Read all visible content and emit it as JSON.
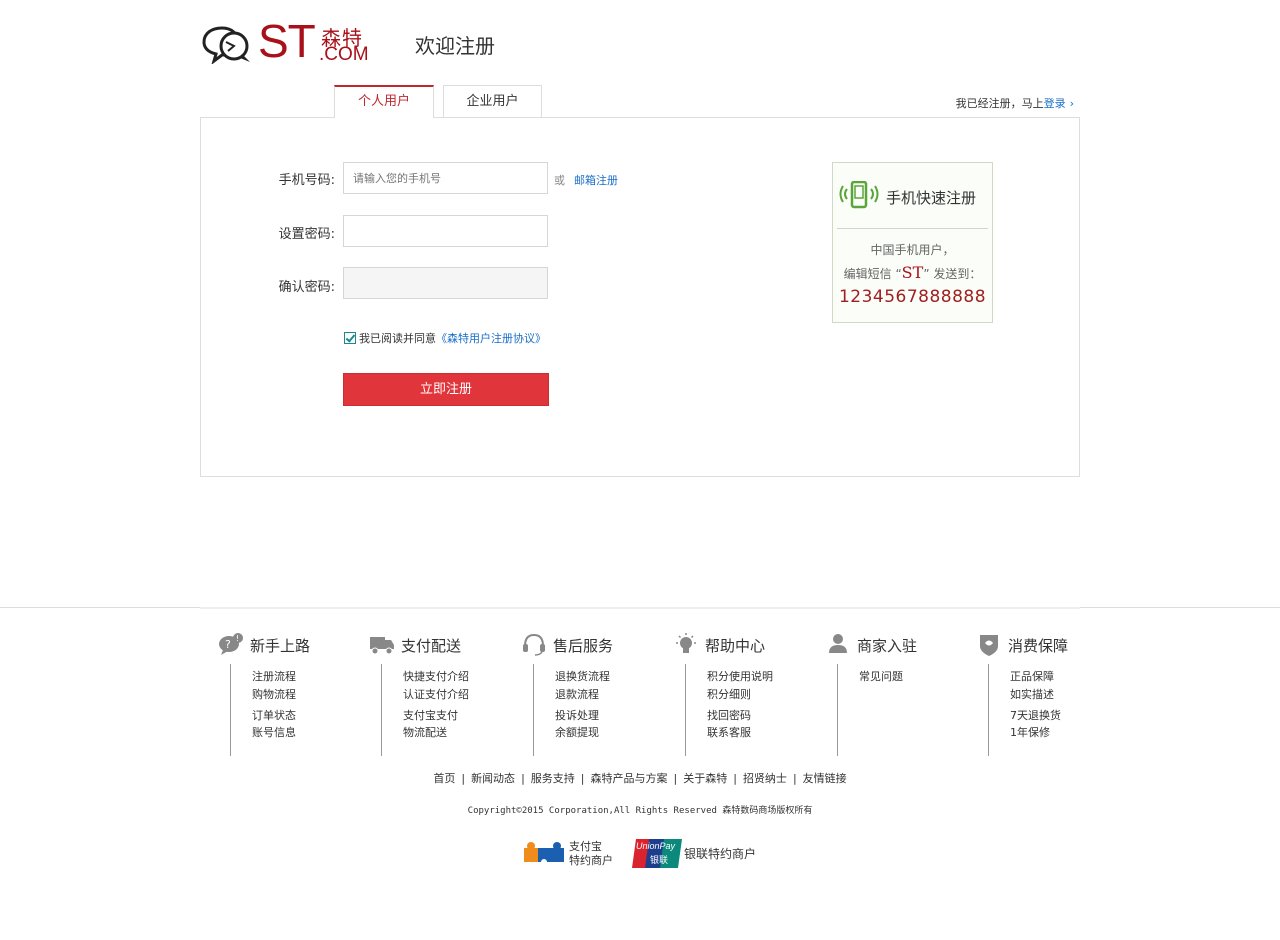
{
  "header": {
    "logo_letters": "ST",
    "logo_cn": "森特",
    "logo_com": ".COM",
    "welcome": "欢迎注册"
  },
  "tabs": [
    {
      "label": "个人用户",
      "active": true
    },
    {
      "label": "企业用户",
      "active": false
    }
  ],
  "login_hint": {
    "text": "我已经注册，马上",
    "link": "登录"
  },
  "form": {
    "phone_label": "手机号码:",
    "phone_placeholder": "请输入您的手机号",
    "or_text": "或",
    "email_register_link": "邮箱注册",
    "password_label": "设置密码:",
    "confirm_label": "确认密码:",
    "agree_text": "我已阅读并同意",
    "agreement_link": "《森特用户注册协议》",
    "agree_checked": true,
    "submit_label": "立即注册"
  },
  "quick_register": {
    "title": "手机快速注册",
    "line1": "中国手机用户，",
    "line2_prefix": "编辑短信 “",
    "line2_code": "ST",
    "line2_suffix": "” 发送到：",
    "number": "1234567888888"
  },
  "footer_columns": [
    {
      "icon": "question-chat-icon",
      "title": "新手上路",
      "items": [
        "注册流程",
        "购物流程",
        "订单状态",
        "账号信息"
      ]
    },
    {
      "icon": "truck-icon",
      "title": "支付配送",
      "items": [
        "快捷支付介绍",
        "认证支付介绍",
        "支付宝支付",
        "物流配送"
      ]
    },
    {
      "icon": "headset-icon",
      "title": "售后服务",
      "items": [
        "退换货流程",
        "退款流程",
        "投诉处理",
        "余额提现"
      ]
    },
    {
      "icon": "lightbulb-icon",
      "title": "帮助中心",
      "items": [
        "积分使用说明",
        "积分细则",
        "找回密码",
        "联系客服"
      ]
    },
    {
      "icon": "person-icon",
      "title": "商家入驻",
      "items": [
        "常见问题"
      ]
    },
    {
      "icon": "shield-icon",
      "title": "消费保障",
      "items": [
        "正品保障",
        "如实描述",
        "7天退换货",
        "1年保修"
      ]
    }
  ],
  "bottom_links": [
    "首页",
    "新闻动态",
    "服务支持",
    "森特产品与方案",
    "关于森特",
    "招贤纳士",
    "友情链接"
  ],
  "copyright": "Copyright©2015 Corporation,All Rights Reserved 森特数码商场版权所有",
  "badges": {
    "alipay_line1": "支付宝",
    "alipay_line2": "特约商户",
    "union_logo_en": "UnionPay",
    "union_logo_cn": "银联",
    "union_text": "银联特约商户"
  },
  "colors": {
    "brand_red": "#a8101a",
    "button_red": "#e0353b",
    "link_blue": "#1a6ec7",
    "quick_green": "#5aa53a"
  }
}
